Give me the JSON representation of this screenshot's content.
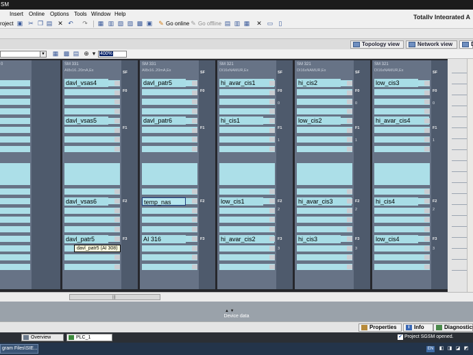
{
  "window": {
    "title": "SM"
  },
  "menu": {
    "items": [
      "Insert",
      "Online",
      "Options",
      "Tools",
      "Window",
      "Help"
    ],
    "portal_title": "Totally Integrated A"
  },
  "toolbar": {
    "project_label": "roject",
    "go_online": "Go online",
    "go_offline": "Go offline"
  },
  "view_tabs": {
    "topology": "Topology view",
    "network": "Network view",
    "device": "D"
  },
  "editor_toolbar": {
    "zoom": "400%"
  },
  "left_module": {
    "type": "0"
  },
  "modules": [
    {
      "type": "SM 331",
      "order": "AI8x16..20mA,Ex",
      "leds": [
        "SF",
        "F0",
        "",
        "",
        "F1",
        "",
        "",
        "",
        "F2",
        "",
        "",
        "F3"
      ],
      "names": [
        "davl_vsas4",
        "davl_vsas5",
        "davl_vsas6",
        "davl_patr5"
      ]
    },
    {
      "type": "SM 331",
      "order": "AI8x16..20mA,Ex",
      "leds": [
        "SF",
        "F0",
        "",
        "",
        "F1",
        "",
        "",
        "",
        "F2",
        "",
        "",
        "F3"
      ],
      "names": [
        "davl_patr5",
        "davl_patr6",
        "temp_nas",
        "AI 316"
      ]
    },
    {
      "type": "SM 321",
      "order": "DI16xNAMUR,Ex",
      "leds": [
        "SF",
        "F0",
        "0",
        "",
        "F1",
        "1",
        "",
        "",
        "F2",
        "2",
        "",
        "F3",
        "3"
      ],
      "names": [
        "hi_avar_cis1",
        "hi_cis1",
        "low_cis1",
        "hi_avar_cis2"
      ]
    },
    {
      "type": "SM 321",
      "order": "DI16xNAMUR,Ex",
      "leds": [
        "SF",
        "F0",
        "0",
        "",
        "F1",
        "1",
        "",
        "",
        "F2",
        "2",
        "",
        "F3",
        "3"
      ],
      "names": [
        "hi_cis2",
        "low_cis2",
        "hi_avar_cis3",
        "hi_cis3"
      ]
    },
    {
      "type": "SM 321",
      "order": "DI16xNAMUR,Ex",
      "leds": [
        "SF",
        "F0",
        "0",
        "",
        "F1",
        "1",
        "",
        "",
        "F2",
        "2",
        "",
        "F3",
        "3"
      ],
      "names": [
        "low_cis3",
        "hi_avar_cis4",
        "hi_cis4",
        "low_cis4"
      ]
    }
  ],
  "tooltip": "davl_patr5 (AI 308)",
  "device_data": {
    "label": "Device data"
  },
  "inspector_tabs": {
    "properties": "Properties",
    "info": "Info",
    "diagnostics": "Diagnostics"
  },
  "portal_bar": {
    "overview": "Overview",
    "plc": "PLC_1",
    "status": "Project SGSM opened."
  },
  "taskbar": {
    "task": "gram Files\\SIE...",
    "lang": "EN"
  }
}
